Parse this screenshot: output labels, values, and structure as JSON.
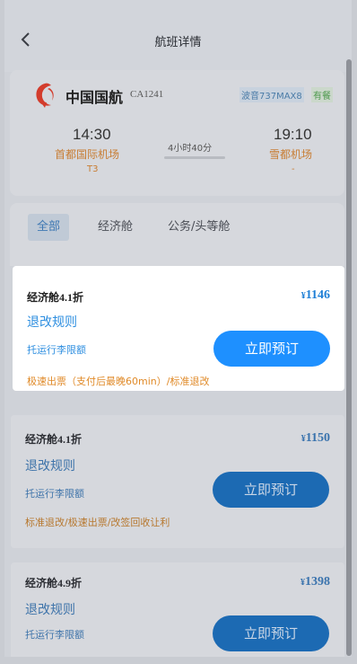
{
  "header": {
    "title": "航班详情"
  },
  "flight": {
    "airline": "中国国航",
    "flight_no": "CA1241",
    "aircraft": "波音737MAX8",
    "meal": "有餐",
    "departure": {
      "time": "14:30",
      "airport": "首都国际机场",
      "terminal": "T3"
    },
    "arrival": {
      "time": "19:10",
      "airport": "雪都机场",
      "terminal": "-"
    },
    "duration": "4小时40分"
  },
  "tabs": [
    {
      "label": "全部",
      "active": true
    },
    {
      "label": "经济舱",
      "active": false
    },
    {
      "label": "公务/头等舱",
      "active": false
    }
  ],
  "offers": [
    {
      "cabin": "经济舱4.1折",
      "currency": "¥",
      "price": "1146",
      "rules": "退改规则",
      "baggage": "托运行李限额",
      "note": "极速出票（支付后最晚60min）/标准退改",
      "book": "立即预订"
    },
    {
      "cabin": "经济舱4.1折",
      "currency": "¥",
      "price": "1150",
      "rules": "退改规则",
      "baggage": "托运行李限额",
      "note": "标准退改/极速出票/改签回收让利",
      "book": "立即预订"
    },
    {
      "cabin": "经济舱4.9折",
      "currency": "¥",
      "price": "1398",
      "rules": "退改规则",
      "baggage": "托运行李限额",
      "book": "立即预订"
    }
  ]
}
